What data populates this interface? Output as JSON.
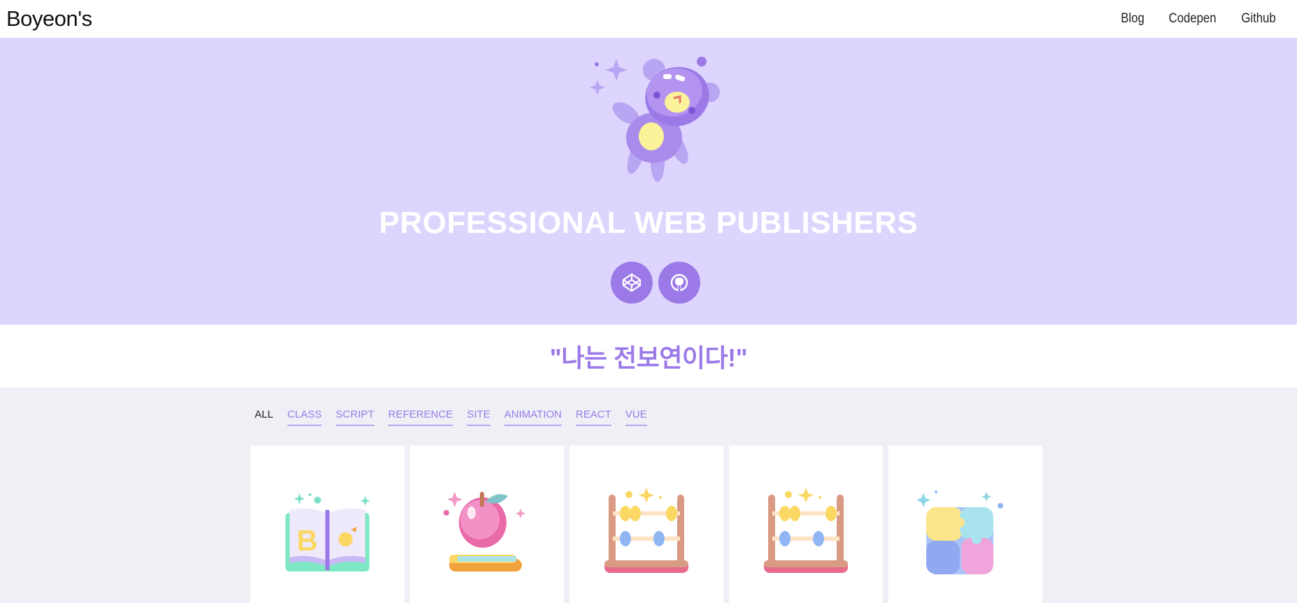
{
  "header": {
    "brand": "Boyeon's",
    "nav": [
      {
        "label": "Blog"
      },
      {
        "label": "Codepen"
      },
      {
        "label": "Github"
      }
    ]
  },
  "hero": {
    "title": "PROFESSIONAL WEB PUBLISHERS",
    "buttons": [
      {
        "icon": "codepen-icon"
      },
      {
        "icon": "github-icon"
      }
    ]
  },
  "quote": "\"나는 전보연이다!\"",
  "filters": [
    {
      "label": "ALL",
      "active": true
    },
    {
      "label": "CLASS"
    },
    {
      "label": "SCRIPT"
    },
    {
      "label": "REFERENCE"
    },
    {
      "label": "SITE"
    },
    {
      "label": "ANIMATION"
    },
    {
      "label": "REACT"
    },
    {
      "label": "VUE"
    }
  ],
  "cards": [
    {
      "icon": "open-book-icon"
    },
    {
      "icon": "apple-on-books-icon"
    },
    {
      "icon": "abacus-icon"
    },
    {
      "icon": "abacus-icon"
    },
    {
      "icon": "puzzle-icon"
    }
  ],
  "colors": {
    "accent": "#9b7ae8",
    "hero_bg": "#ddd5fd",
    "section_bg": "#eef0f6"
  }
}
